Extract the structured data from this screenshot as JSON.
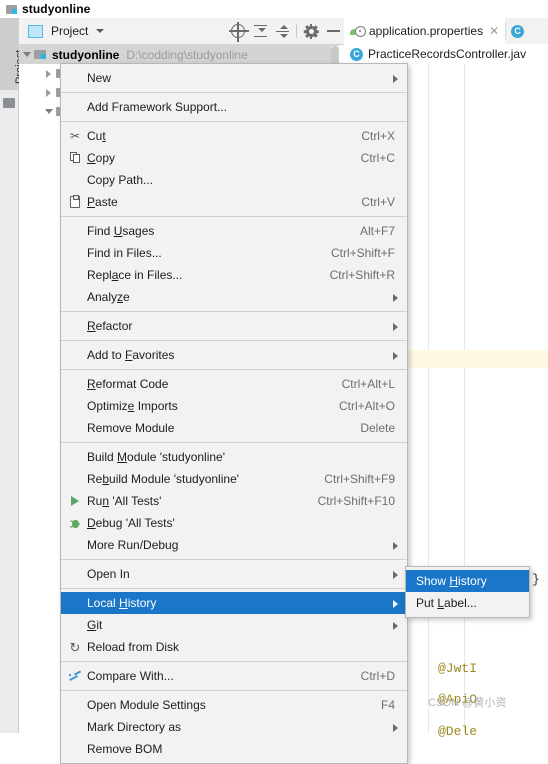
{
  "window": {
    "title": "studyonline",
    "icon": "project-folder-icon"
  },
  "left_strip": {
    "tool_tab": "Project",
    "folder_icon": "folder-icon"
  },
  "project_panel": {
    "toolbar": {
      "title": "Project",
      "dropdown_icon": "chevron-down-icon",
      "buttons": [
        {
          "name": "select-opened-file-icon",
          "label": ""
        },
        {
          "name": "expand-all-icon",
          "label": ""
        },
        {
          "name": "collapse-all-icon",
          "label": ""
        },
        {
          "name": "settings-gear-icon",
          "label": ""
        },
        {
          "name": "hide-panel-icon",
          "label": ""
        }
      ]
    },
    "tree": {
      "root": {
        "label": "studyonline",
        "path": "D:\\codding\\studyonline",
        "expanded": true
      },
      "children": [
        {
          "label": "",
          "expanded": false
        },
        {
          "label": "",
          "expanded": false
        },
        {
          "label": "",
          "expanded": true
        },
        {
          "label": "",
          "expanded": true
        }
      ]
    }
  },
  "editor": {
    "tabs": [
      {
        "label": "application.properties",
        "icon": "properties-file-icon",
        "active": true,
        "closable": true
      },
      {
        "label": "C",
        "icon": "java-class-icon",
        "active": false,
        "closable": false
      }
    ],
    "breadcrumb": {
      "icon": "java-class-icon",
      "label": "PracticeRecordsController.jav"
    },
    "code_lines": [
      {
        "text": "@JwtI",
        "color": "#9d8a1f"
      },
      {
        "text": "@ApiO",
        "color": "#9d8a1f"
      },
      {
        "text": "@Dele",
        "color": "#9d8a1f"
      }
    ],
    "closing_brace": "}",
    "fold_markers": [
      "fold-collapse-icon",
      "fold-collapse-icon",
      "fold-collapse-icon",
      "fold-collapse-icon",
      "fold-collapse-icon"
    ]
  },
  "watermark": "CSDN @黄小资",
  "context_menu": {
    "items": [
      {
        "label": "New",
        "accel": "",
        "icon": "",
        "submenu": true,
        "selected": false
      },
      {
        "sep": true
      },
      {
        "label": "Add Framework Support...",
        "accel": "",
        "icon": "",
        "submenu": false,
        "selected": false
      },
      {
        "sep": true
      },
      {
        "label": "Cut",
        "accel": "Ctrl+X",
        "icon": "cut-scissors-icon",
        "submenu": false,
        "selected": false,
        "mnemonic": 2
      },
      {
        "label": "Copy",
        "accel": "Ctrl+C",
        "icon": "copy-icon",
        "submenu": false,
        "selected": false,
        "mnemonic": 0
      },
      {
        "label": "Copy Path...",
        "accel": "",
        "icon": "",
        "submenu": false,
        "selected": false
      },
      {
        "label": "Paste",
        "accel": "Ctrl+V",
        "icon": "paste-icon",
        "submenu": false,
        "selected": false,
        "mnemonic": 0
      },
      {
        "sep": true
      },
      {
        "label": "Find Usages",
        "accel": "Alt+F7",
        "icon": "",
        "submenu": false,
        "selected": false,
        "mnemonic": 5
      },
      {
        "label": "Find in Files...",
        "accel": "Ctrl+Shift+F",
        "icon": "",
        "submenu": false,
        "selected": false
      },
      {
        "label": "Replace in Files...",
        "accel": "Ctrl+Shift+R",
        "icon": "",
        "submenu": false,
        "selected": false,
        "mnemonic": 4
      },
      {
        "label": "Analyze",
        "accel": "",
        "icon": "",
        "submenu": true,
        "selected": false,
        "mnemonic": 5
      },
      {
        "sep": true
      },
      {
        "label": "Refactor",
        "accel": "",
        "icon": "",
        "submenu": true,
        "selected": false,
        "mnemonic": 0
      },
      {
        "sep": true
      },
      {
        "label": "Add to Favorites",
        "accel": "",
        "icon": "",
        "submenu": true,
        "selected": false,
        "mnemonic": 7
      },
      {
        "sep": true
      },
      {
        "label": "Reformat Code",
        "accel": "Ctrl+Alt+L",
        "icon": "",
        "submenu": false,
        "selected": false,
        "mnemonic": 0
      },
      {
        "label": "Optimize Imports",
        "accel": "Ctrl+Alt+O",
        "icon": "",
        "submenu": false,
        "selected": false,
        "mnemonic": 7
      },
      {
        "label": "Remove Module",
        "accel": "Delete",
        "icon": "",
        "submenu": false,
        "selected": false
      },
      {
        "sep": true
      },
      {
        "label": "Build Module 'studyonline'",
        "accel": "",
        "icon": "",
        "submenu": false,
        "selected": false,
        "mnemonic": 6
      },
      {
        "label": "Rebuild Module 'studyonline'",
        "accel": "Ctrl+Shift+F9",
        "icon": "",
        "submenu": false,
        "selected": false,
        "mnemonic": 2
      },
      {
        "label": "Run 'All Tests'",
        "accel": "Ctrl+Shift+F10",
        "icon": "run-play-icon",
        "submenu": false,
        "selected": false,
        "mnemonic": 2
      },
      {
        "label": "Debug 'All Tests'",
        "accel": "",
        "icon": "debug-bug-icon",
        "submenu": false,
        "selected": false,
        "mnemonic": 0
      },
      {
        "label": "More Run/Debug",
        "accel": "",
        "icon": "",
        "submenu": true,
        "selected": false
      },
      {
        "sep": true
      },
      {
        "label": "Open In",
        "accel": "",
        "icon": "",
        "submenu": true,
        "selected": false
      },
      {
        "sep": true
      },
      {
        "label": "Local History",
        "accel": "",
        "icon": "",
        "submenu": true,
        "selected": true,
        "mnemonic": 6
      },
      {
        "label": "Git",
        "accel": "",
        "icon": "",
        "submenu": true,
        "selected": false,
        "mnemonic": 0
      },
      {
        "label": "Reload from Disk",
        "accel": "",
        "icon": "reload-icon",
        "submenu": false,
        "selected": false
      },
      {
        "sep": true
      },
      {
        "label": "Compare With...",
        "accel": "Ctrl+D",
        "icon": "compare-icon",
        "submenu": false,
        "selected": false
      },
      {
        "sep": true
      },
      {
        "label": "Open Module Settings",
        "accel": "F4",
        "icon": "",
        "submenu": false,
        "selected": false
      },
      {
        "label": "Mark Directory as",
        "accel": "",
        "icon": "",
        "submenu": true,
        "selected": false
      },
      {
        "label": "Remove BOM",
        "accel": "",
        "icon": "",
        "submenu": false,
        "selected": false
      }
    ]
  },
  "submenu": {
    "parent": "Local History",
    "items": [
      {
        "label": "Show History",
        "selected": true,
        "mnemonic": 5
      },
      {
        "label": "Put Label...",
        "selected": false,
        "mnemonic": 4
      }
    ]
  },
  "colors": {
    "selection_blue": "#1976c8",
    "menu_bg": "#f2f2f2",
    "tree_root_bg": "#d4d4d4",
    "gutter_bg": "#ececec",
    "annotation_yellow": "#9d8a1f",
    "fold_green": "#c4e0bb",
    "fold_blue": "#b9d0e8",
    "current_line_yellow": "#fdf9e3"
  }
}
